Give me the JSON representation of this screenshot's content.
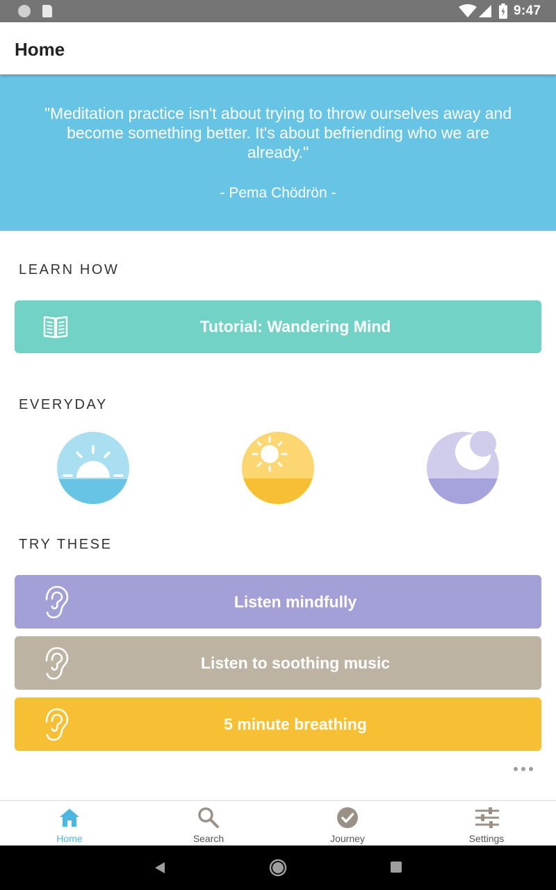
{
  "status_bar": {
    "time": "9:47"
  },
  "app_bar": {
    "title": "Home"
  },
  "quote": {
    "text": "\"Meditation practice isn't about trying to throw ourselves away and become something better. It's about befriending who we are already.\"",
    "author": "- Pema Chödrön -",
    "background": "#68c4e5"
  },
  "learn_how": {
    "heading": "LEARN HOW",
    "card": {
      "label": "Tutorial: Wandering Mind",
      "icon": "book-icon",
      "color": "#72d2c5"
    }
  },
  "everyday": {
    "heading": "EVERYDAY",
    "items": [
      {
        "icon": "sunrise-icon",
        "colors": [
          "#a9dff1",
          "#68c4e5"
        ]
      },
      {
        "icon": "sun-icon",
        "colors": [
          "#fbd671",
          "#f7bf33"
        ]
      },
      {
        "icon": "moon-icon",
        "colors": [
          "#d0cdec",
          "#a6a2db"
        ]
      }
    ]
  },
  "try_these": {
    "heading": "TRY THESE",
    "cards": [
      {
        "label": "Listen mindfully",
        "icon": "ear-icon",
        "color": "#a3a0d7"
      },
      {
        "label": "Listen to soothing music",
        "icon": "ear-icon",
        "color": "#bcb3a3"
      },
      {
        "label": "5 minute breathing",
        "icon": "ear-icon",
        "color": "#f7bf33"
      }
    ]
  },
  "bottom_nav": {
    "items": [
      {
        "label": "Home",
        "icon": "home-icon",
        "active": true
      },
      {
        "label": "Search",
        "icon": "search-icon",
        "active": false
      },
      {
        "label": "Journey",
        "icon": "check-circle-icon",
        "active": false
      },
      {
        "label": "Settings",
        "icon": "sliders-icon",
        "active": false
      }
    ],
    "active_color": "#4db7e2",
    "inactive_color": "#9a9186"
  }
}
